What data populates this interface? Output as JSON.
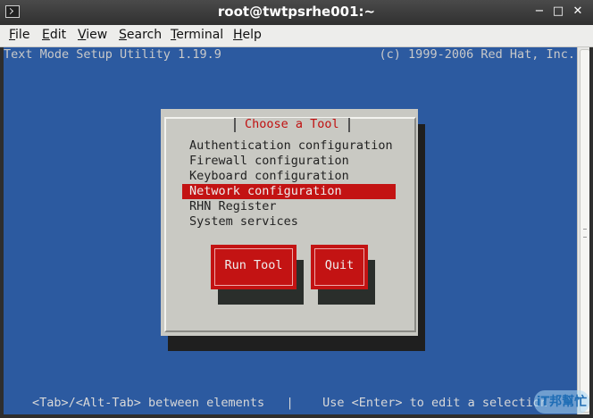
{
  "window": {
    "title": "root@twtpsrhe001:~",
    "buttons": {
      "minimize": "−",
      "maximize": "□",
      "close": "✕"
    }
  },
  "menu": {
    "items": [
      {
        "label": "File",
        "mnemonic": "F",
        "rest": "ile"
      },
      {
        "label": "Edit",
        "mnemonic": "E",
        "rest": "dit"
      },
      {
        "label": "View",
        "mnemonic": "V",
        "rest": "iew"
      },
      {
        "label": "Search",
        "mnemonic": "S",
        "rest": "earch"
      },
      {
        "label": "Terminal",
        "mnemonic": "T",
        "rest": "erminal"
      },
      {
        "label": "Help",
        "mnemonic": "H",
        "rest": "elp"
      }
    ]
  },
  "terminal": {
    "header_left": "Text Mode Setup Utility 1.19.9",
    "header_right": "(c) 1999-2006 Red Hat, Inc.",
    "status_line": "<Tab>/<Alt-Tab> between elements   |    Use <Enter> to edit a selection"
  },
  "dialog": {
    "title": "Choose a Tool",
    "items": [
      "Authentication configuration",
      "Firewall configuration",
      "Keyboard configuration",
      "Network configuration",
      "RHN Register",
      "System services"
    ],
    "selected_index": 3,
    "run_button": "Run Tool",
    "quit_button": "Quit"
  },
  "watermark": {
    "text": "iT邦幫忙"
  },
  "colors": {
    "terminal_bg": "#2c5aa0",
    "dialog_bg": "#c9c9c3",
    "accent_red": "#c31313"
  }
}
